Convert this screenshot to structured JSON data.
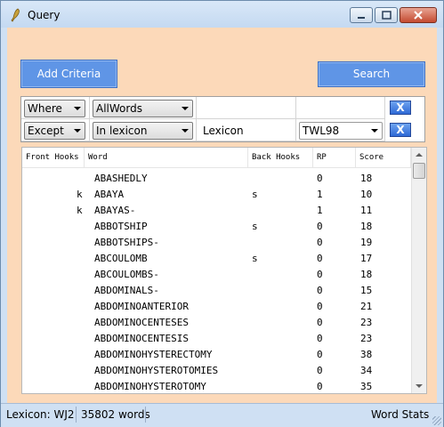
{
  "window": {
    "title": "Query"
  },
  "toolbar": {
    "add_criteria_label": "Add Criteria",
    "search_label": "Search"
  },
  "criteria": {
    "row1": {
      "mode": "Where",
      "field": "AllWords",
      "value": "",
      "extra": ""
    },
    "row2": {
      "mode": "Except",
      "field": "In lexicon",
      "value": "Lexicon",
      "extra": "TWL98"
    },
    "remove_label": "X"
  },
  "results": {
    "columns": [
      "Front Hooks",
      "Word",
      "Back Hooks",
      "RP",
      "Score"
    ],
    "rows": [
      {
        "front": "",
        "word": "ABASHEDLY",
        "back": "",
        "rp": "0",
        "score": "18"
      },
      {
        "front": "k",
        "word": "ABAYA",
        "back": "s",
        "rp": "1",
        "score": "10"
      },
      {
        "front": "k",
        "word": "ABAYAS-",
        "back": "",
        "rp": "1",
        "score": "11"
      },
      {
        "front": "",
        "word": "ABBOTSHIP",
        "back": "s",
        "rp": "0",
        "score": "18"
      },
      {
        "front": "",
        "word": "ABBOTSHIPS-",
        "back": "",
        "rp": "0",
        "score": "19"
      },
      {
        "front": "",
        "word": "ABCOULOMB",
        "back": "s",
        "rp": "0",
        "score": "17"
      },
      {
        "front": "",
        "word": "ABCOULOMBS-",
        "back": "",
        "rp": "0",
        "score": "18"
      },
      {
        "front": "",
        "word": "ABDOMINALS-",
        "back": "",
        "rp": "0",
        "score": "15"
      },
      {
        "front": "",
        "word": "ABDOMINOANTERIOR",
        "back": "",
        "rp": "0",
        "score": "21"
      },
      {
        "front": "",
        "word": "ABDOMINOCENTESES",
        "back": "",
        "rp": "0",
        "score": "23"
      },
      {
        "front": "",
        "word": "ABDOMINOCENTESIS",
        "back": "",
        "rp": "0",
        "score": "23"
      },
      {
        "front": "",
        "word": "ABDOMINOHYSTERECTOMY",
        "back": "",
        "rp": "0",
        "score": "38"
      },
      {
        "front": "",
        "word": "ABDOMINOHYSTEROTOMIES",
        "back": "",
        "rp": "0",
        "score": "34"
      },
      {
        "front": "",
        "word": "ABDOMINOHYSTEROTOMY",
        "back": "",
        "rp": "0",
        "score": "35"
      }
    ]
  },
  "status": {
    "lexicon": "Lexicon: WJ2",
    "count": "35802 words",
    "stats": "Word Stats"
  },
  "colors": {
    "client_bg": "#fcd9b9",
    "button_bg": "#5f95e6",
    "titlebar": "#cfe0f3"
  }
}
